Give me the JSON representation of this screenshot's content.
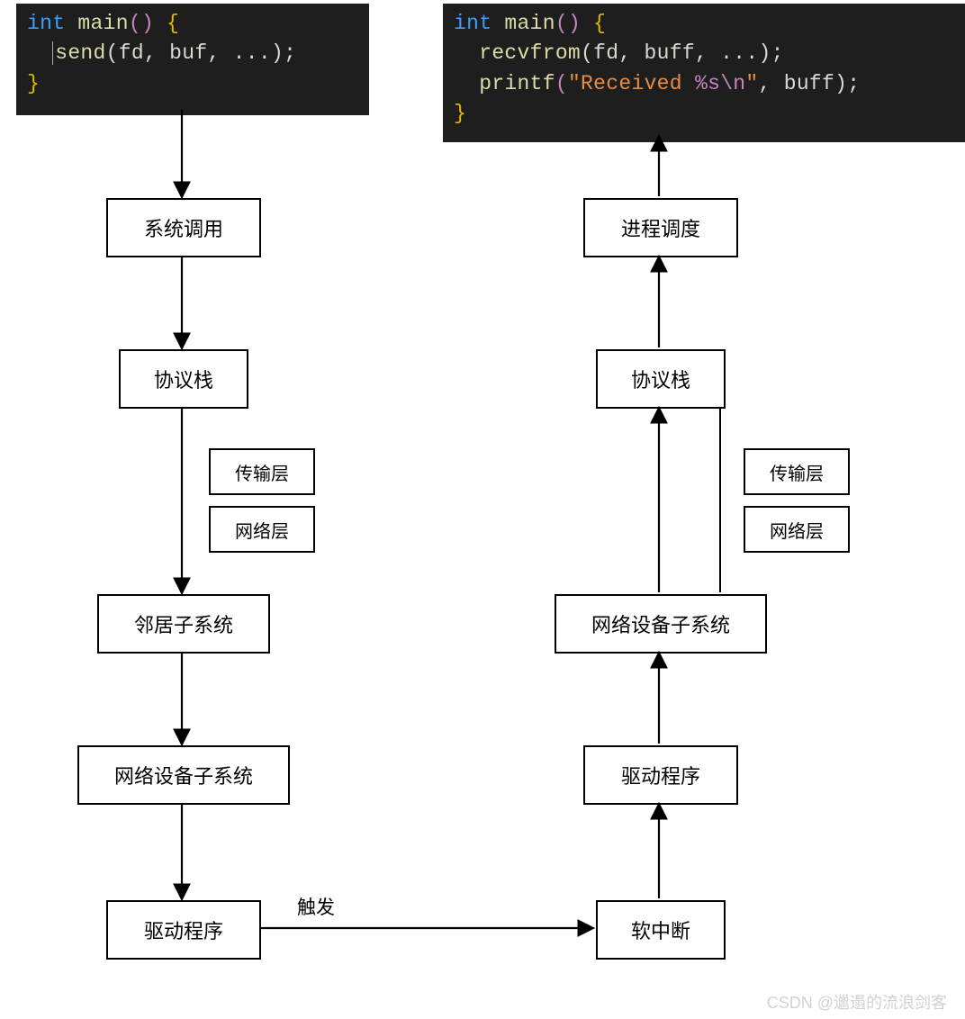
{
  "code_left": {
    "l1_kw": "int",
    "l1_fn": "main",
    "l1_pars": "()",
    "l1_brace": "{",
    "l2_fn": "send",
    "l2_args": "(fd, buf, ...)",
    "l2_end": ";",
    "l3_brace": "}"
  },
  "code_right": {
    "l1_kw": "int",
    "l1_fn": "main",
    "l1_pars": "()",
    "l1_brace": "{",
    "l2_fn": "recvfrom",
    "l2_args": "(fd, buff, ...)",
    "l2_end": ";",
    "l3_fn": "printf",
    "l3_open": "(",
    "l3_str1": "\"Received ",
    "l3_esc": "%s\\n",
    "l3_str2": "\"",
    "l3_rest": ", buff)",
    "l3_end": ";",
    "l4_brace": "}"
  },
  "left_boxes": {
    "syscall": "系统调用",
    "stack": "协议栈",
    "transport": "传输层",
    "network": "网络层",
    "neighbor": "邻居子系统",
    "netdev": "网络设备子系统",
    "driver": "驱动程序"
  },
  "right_boxes": {
    "sched": "进程调度",
    "stack": "协议栈",
    "transport": "传输层",
    "network": "网络层",
    "netdev": "网络设备子系统",
    "driver": "驱动程序",
    "softirq": "软中断"
  },
  "edge_label": "触发",
  "watermark": "CSDN @邋遢的流浪剑客"
}
